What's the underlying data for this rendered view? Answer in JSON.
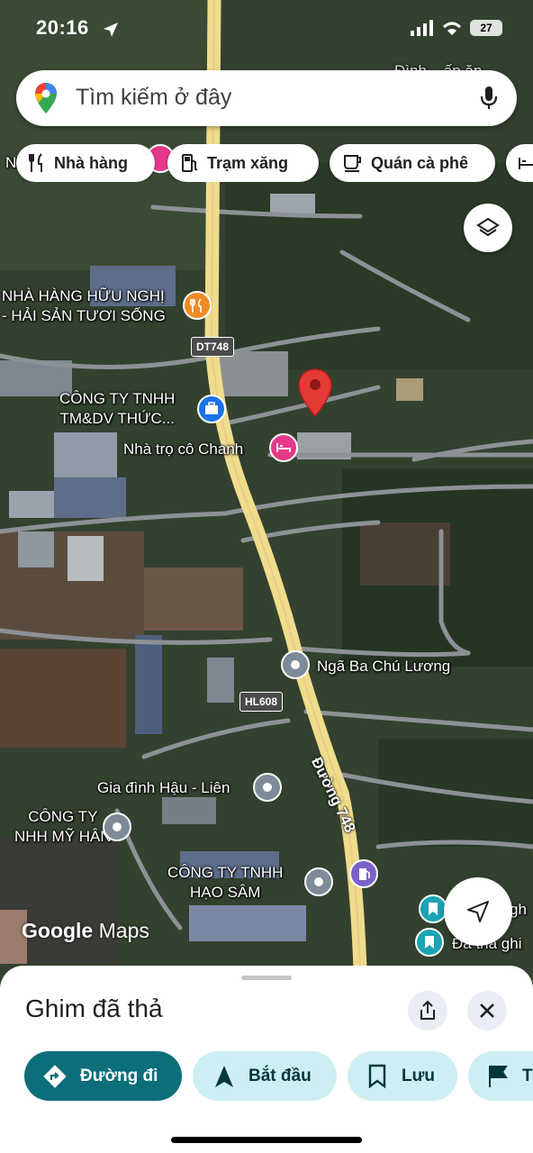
{
  "status_bar": {
    "time": "20:16",
    "battery": "27"
  },
  "search": {
    "placeholder": "Tìm kiếm ở đây"
  },
  "chips": [
    {
      "label": "Nhà hàng",
      "icon": "fork-knife-icon"
    },
    {
      "label": "Trạm xăng",
      "icon": "gas-pump-icon"
    },
    {
      "label": "Quán cà phê",
      "icon": "coffee-cup-icon"
    },
    {
      "label": "",
      "icon": "bed-icon"
    }
  ],
  "map": {
    "places": {
      "restaurant_line1": "NHÀ HÀNG HỮU NGHỊ",
      "restaurant_line2": "- HẢI SẢN TƯƠI SỐNG",
      "company1_line1": "CÔNG TY TNHH",
      "company1_line2": "TM&DV THỨC...",
      "motel": "Nhà trọ cô Chanh",
      "junction": "Ngã Ba Chú Lương",
      "family": "Gia đình Hậu - Liên",
      "company2_line1": "CÔNG TY",
      "company2_line2": "NHH MỸ HÂN",
      "company3_line1": "CÔNG TY TNHH",
      "company3_line2": "HẠO SÂM",
      "saved1": "gh",
      "saved2": "Đà thà ghi",
      "top_right_fragment": "Đình ...ấp ặn",
      "top_left_fragment": "N"
    },
    "road_shields": {
      "dt748": "DT748",
      "hl608": "HL608"
    },
    "road_name": "Đường 748",
    "colors": {
      "main_road": "#f0dc8c",
      "pin": "#e53935",
      "poi_blue": "#1a73e8",
      "poi_pink": "#e5398a",
      "poi_orange": "#f08a24",
      "poi_gray": "#7d8a97",
      "poi_teal": "#1aa4b4",
      "poi_purple": "#7b61c9"
    }
  },
  "logo": {
    "google": "Google",
    "maps": "Maps"
  },
  "sheet": {
    "title": "Ghim đã thả",
    "actions": [
      {
        "label": "Đường đi",
        "icon": "directions-icon"
      },
      {
        "label": "Bắt đầu",
        "icon": "navigation-arrow-icon"
      },
      {
        "label": "Lưu",
        "icon": "bookmark-icon"
      },
      {
        "label": "T",
        "icon": "flag-icon"
      }
    ]
  }
}
